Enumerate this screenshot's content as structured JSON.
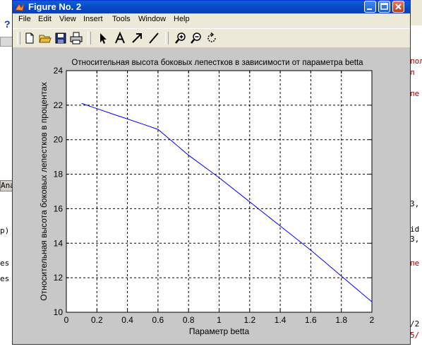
{
  "window": {
    "title": "Figure No. 2",
    "menu": [
      "File",
      "Edit",
      "View",
      "Insert",
      "Tools",
      "Window",
      "Help"
    ],
    "toolbar_icons": [
      "new-file-icon",
      "open-folder-icon",
      "save-icon",
      "print-icon",
      "arrow-select-icon",
      "text-insert-icon",
      "arrow-insert-icon",
      "line-insert-icon",
      "zoom-in-icon",
      "zoom-out-icon",
      "rotate-3d-icon"
    ]
  },
  "background": {
    "left_snippets": [
      "Ana",
      "p)",
      "es",
      "es"
    ],
    "left_help": "?",
    "right_snippets": [
      "пол",
      " л",
      "пе",
      "3,",
      "id",
      "3,",
      "пе",
      "/2",
      "5/"
    ]
  },
  "chart_data": {
    "type": "line",
    "title": "Относительная высота боковых лепестков в зависимости от параметра betta",
    "xlabel": "Параметр betta",
    "ylabel": "Относительная высота боковых лепестков в процентах",
    "xlim": [
      0,
      2
    ],
    "ylim": [
      10,
      24
    ],
    "xticks": [
      "0",
      "0.2",
      "0.4",
      "0.6",
      "0.8",
      "1",
      "1.2",
      "1.4",
      "1.6",
      "1.8",
      "2"
    ],
    "yticks": [
      "10",
      "12",
      "14",
      "16",
      "18",
      "20",
      "22",
      "24"
    ],
    "grid": true,
    "series": [
      {
        "color": "#0000ff",
        "x": [
          0.1,
          0.2,
          0.3,
          0.4,
          0.5,
          0.6,
          0.8,
          1.0,
          1.2,
          1.4,
          1.6,
          1.8,
          2.0
        ],
        "y": [
          22.1,
          21.8,
          21.5,
          21.2,
          20.9,
          20.6,
          19.1,
          17.8,
          16.4,
          15.0,
          13.6,
          12.1,
          10.6
        ]
      }
    ]
  }
}
